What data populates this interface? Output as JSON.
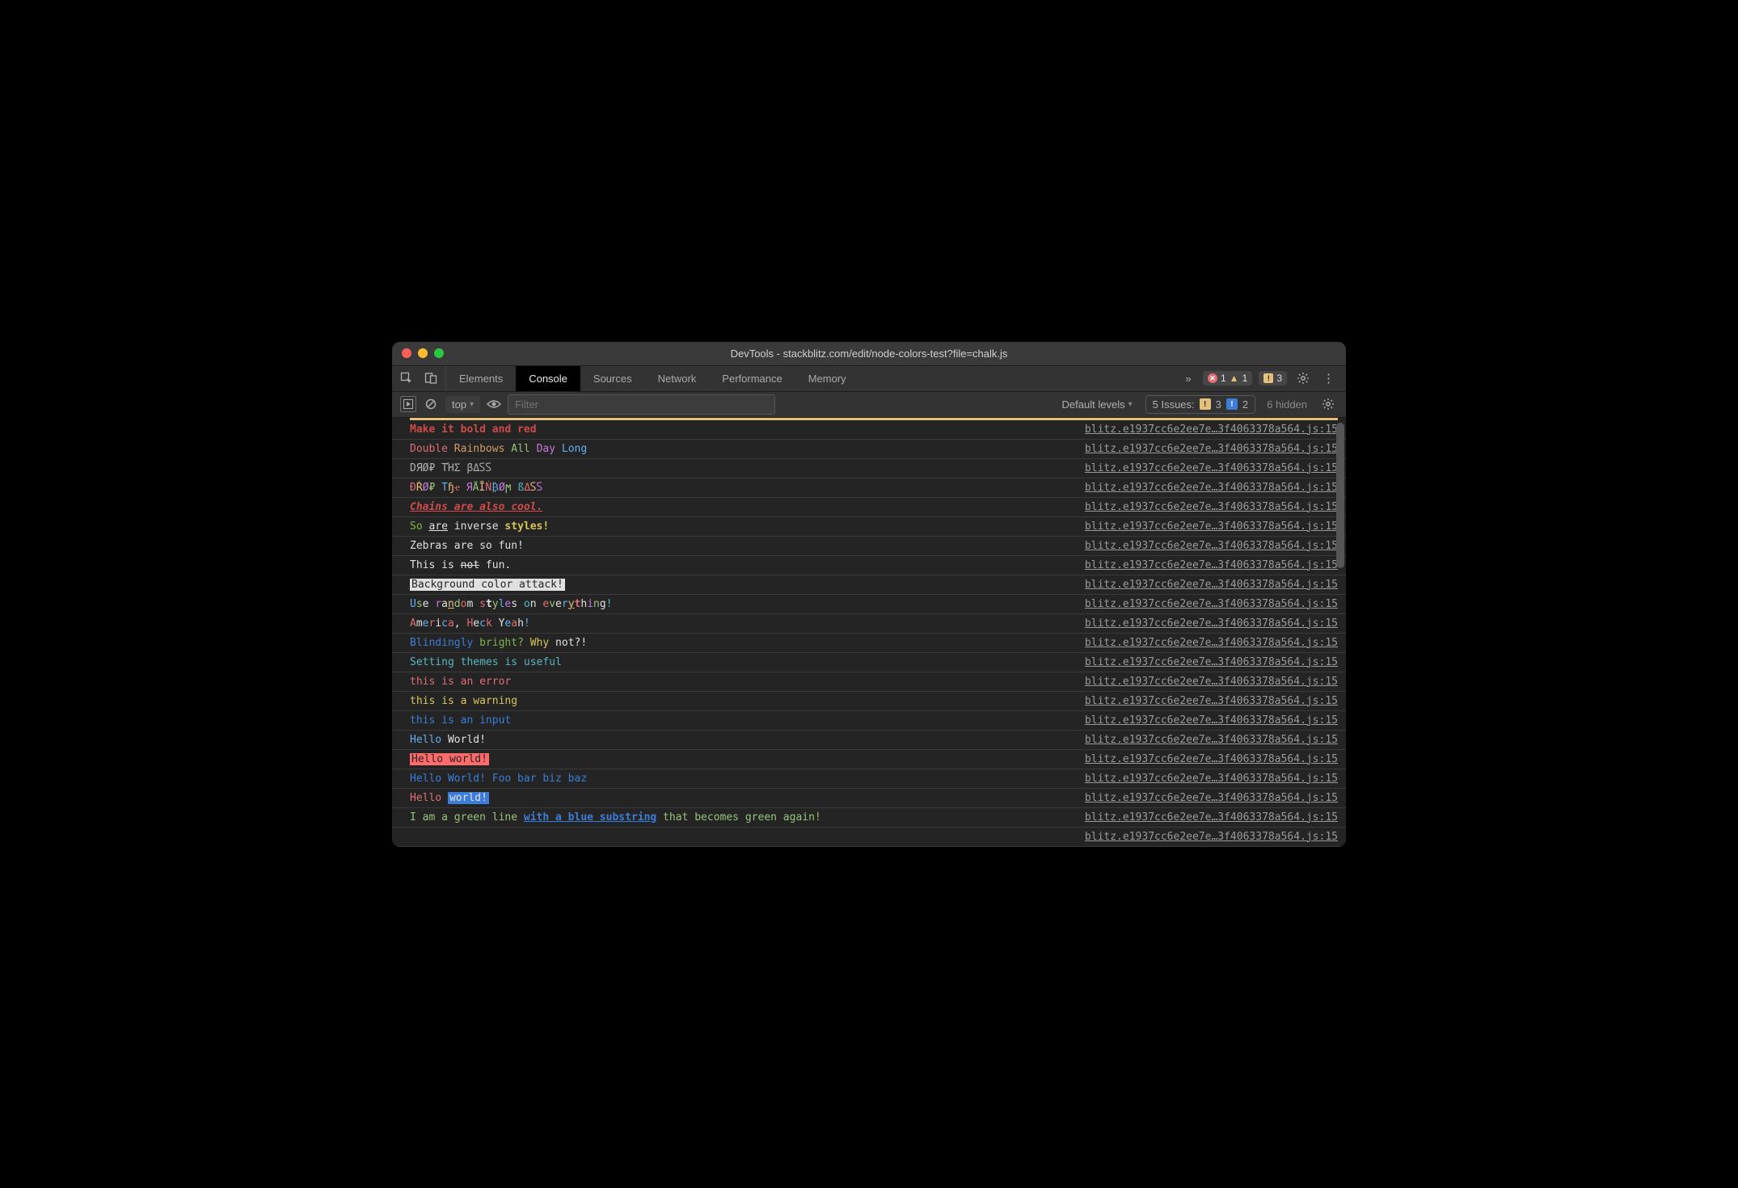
{
  "window": {
    "title": "DevTools - stackblitz.com/edit/node-colors-test?file=chalk.js"
  },
  "tabs": {
    "items": [
      "Elements",
      "Console",
      "Sources",
      "Network",
      "Performance",
      "Memory"
    ],
    "activeIndex": 1,
    "overflow_glyph": "»"
  },
  "badges": {
    "errors": "1",
    "warnings": "1",
    "issues": "3"
  },
  "toolbar": {
    "context": "top",
    "filter_placeholder": "Filter",
    "levels": "Default levels",
    "issues_label": "5 Issues:",
    "issues_warn": "3",
    "issues_info": "2",
    "hidden": "6 hidden"
  },
  "source_link": "blitz.e1937cc6e2ee7e…3f4063378a564.js:15",
  "lines": [
    {
      "parts": [
        {
          "t": "Make it bold and red",
          "cls": "bold red2"
        }
      ]
    },
    {
      "parts": [
        {
          "t": "Double",
          "cls": "red"
        },
        {
          "t": " "
        },
        {
          "t": "Rainbows",
          "cls": "orange"
        },
        {
          "t": " "
        },
        {
          "t": "All",
          "cls": "green"
        },
        {
          "t": " "
        },
        {
          "t": "Day",
          "cls": "magenta"
        },
        {
          "t": " "
        },
        {
          "t": "Long",
          "cls": "blue"
        }
      ]
    },
    {
      "parts": [
        {
          "t": "DЯØ₽ TΉΣ βΔ𐊖𐊖",
          "cls": "gray"
        }
      ]
    },
    {
      "parts": [
        {
          "t": "Ð",
          "cls": "red"
        },
        {
          "t": "Ŕ",
          "cls": "yellow"
        },
        {
          "t": "Ø",
          "cls": "magenta"
        },
        {
          "t": "₽",
          "cls": "green"
        },
        {
          "t": " "
        },
        {
          "t": "T",
          "cls": "blue"
        },
        {
          "t": "ɧ",
          "cls": "yellow"
        },
        {
          "t": "ҽ",
          "cls": "red"
        },
        {
          "t": " "
        },
        {
          "t": "Я",
          "cls": "magenta"
        },
        {
          "t": "Ǟ",
          "cls": "green"
        },
        {
          "t": "Ī",
          "cls": "yellow"
        },
        {
          "t": "Ń",
          "cls": "red"
        },
        {
          "t": "₿",
          "cls": "blue"
        },
        {
          "t": "Ø",
          "cls": "magenta"
        },
        {
          "t": "ϻ",
          "cls": "green"
        },
        {
          "t": " "
        },
        {
          "t": "ß",
          "cls": "cyan"
        },
        {
          "t": "Δ",
          "cls": "red"
        },
        {
          "t": "𐊖",
          "cls": "yellow"
        },
        {
          "t": "𐊖",
          "cls": "magenta"
        }
      ]
    },
    {
      "parts": [
        {
          "t": "Chains are also cool.",
          "cls": "bold italic underline red2"
        }
      ]
    },
    {
      "parts": [
        {
          "t": "So",
          "cls": "green2"
        },
        {
          "t": " "
        },
        {
          "t": "are",
          "cls": "white underline"
        },
        {
          "t": " "
        },
        {
          "t": "inverse",
          "cls": "white"
        },
        {
          "t": " "
        },
        {
          "t": "styles!",
          "cls": "bold yellow2"
        }
      ]
    },
    {
      "parts": [
        {
          "t": "Zebras are so fun!",
          "cls": "white"
        }
      ]
    },
    {
      "parts": [
        {
          "t": "This is ",
          "cls": "white"
        },
        {
          "t": "not",
          "cls": "white strike"
        },
        {
          "t": " fun.",
          "cls": "white"
        }
      ]
    },
    {
      "parts": [
        {
          "t": "Background color attack!",
          "cls": "bgwhite"
        }
      ]
    },
    {
      "parts": [
        {
          "t": "U",
          "cls": "blue"
        },
        {
          "t": "s",
          "cls": "green"
        },
        {
          "t": "e",
          "cls": "white"
        },
        {
          "t": " "
        },
        {
          "t": "r",
          "cls": "magenta"
        },
        {
          "t": "a",
          "cls": "white"
        },
        {
          "t": "n",
          "cls": "yellow underline"
        },
        {
          "t": "d",
          "cls": "green"
        },
        {
          "t": "o",
          "cls": "red"
        },
        {
          "t": "m",
          "cls": "white"
        },
        {
          "t": " "
        },
        {
          "t": "s",
          "cls": "red"
        },
        {
          "t": "t",
          "cls": "bold white"
        },
        {
          "t": "y",
          "cls": "green"
        },
        {
          "t": "l",
          "cls": "blue"
        },
        {
          "t": "e",
          "cls": "magenta"
        },
        {
          "t": "s",
          "cls": "white"
        },
        {
          "t": " "
        },
        {
          "t": "o",
          "cls": "cyan"
        },
        {
          "t": "n",
          "cls": "white"
        },
        {
          "t": " "
        },
        {
          "t": "e",
          "cls": "red"
        },
        {
          "t": "v",
          "cls": "green"
        },
        {
          "t": "e",
          "cls": "white"
        },
        {
          "t": "r",
          "cls": "blue"
        },
        {
          "t": "y",
          "cls": "yellow underline"
        },
        {
          "t": "t",
          "cls": "bold red"
        },
        {
          "t": "h",
          "cls": "white"
        },
        {
          "t": "i",
          "cls": "magenta"
        },
        {
          "t": "n",
          "cls": "green"
        },
        {
          "t": "g",
          "cls": "white"
        },
        {
          "t": "!",
          "cls": "cyan"
        }
      ]
    },
    {
      "parts": [
        {
          "t": "A",
          "cls": "red"
        },
        {
          "t": "m",
          "cls": "white"
        },
        {
          "t": "e",
          "cls": "blue"
        },
        {
          "t": "r",
          "cls": "red"
        },
        {
          "t": "i",
          "cls": "white"
        },
        {
          "t": "c",
          "cls": "blue"
        },
        {
          "t": "a",
          "cls": "red"
        },
        {
          "t": ", ",
          "cls": "white"
        },
        {
          "t": "H",
          "cls": "red"
        },
        {
          "t": "e",
          "cls": "white"
        },
        {
          "t": "c",
          "cls": "blue"
        },
        {
          "t": "k",
          "cls": "red"
        },
        {
          "t": " "
        },
        {
          "t": "Y",
          "cls": "white"
        },
        {
          "t": "e",
          "cls": "blue"
        },
        {
          "t": "a",
          "cls": "red"
        },
        {
          "t": "h",
          "cls": "white"
        },
        {
          "t": "!",
          "cls": "blue"
        }
      ]
    },
    {
      "parts": [
        {
          "t": "Blindingly",
          "cls": "blue2"
        },
        {
          "t": " "
        },
        {
          "t": "bright?",
          "cls": "green2"
        },
        {
          "t": " "
        },
        {
          "t": "Why",
          "cls": "yellow2"
        },
        {
          "t": " "
        },
        {
          "t": "not?!",
          "cls": "white"
        }
      ]
    },
    {
      "parts": [
        {
          "t": "Setting themes is useful",
          "cls": "cyan"
        }
      ]
    },
    {
      "parts": [
        {
          "t": "this is an error",
          "cls": "red"
        }
      ]
    },
    {
      "parts": [
        {
          "t": "this is a warning",
          "cls": "yellow2"
        }
      ]
    },
    {
      "parts": [
        {
          "t": "this is an input",
          "cls": "blue2"
        }
      ]
    },
    {
      "parts": [
        {
          "t": "Hello",
          "cls": "blue"
        },
        {
          "t": " World!",
          "cls": "white"
        }
      ]
    },
    {
      "parts": [
        {
          "t": "Hello world!",
          "cls": "bgred blue2"
        }
      ]
    },
    {
      "parts": [
        {
          "t": "Hello World! Foo bar biz baz",
          "cls": "blue2"
        }
      ]
    },
    {
      "parts": [
        {
          "t": "Hello ",
          "cls": "red"
        },
        {
          "t": "world!",
          "cls": "bgblue yellow2"
        }
      ]
    },
    {
      "parts": [
        {
          "t": "I am a green line ",
          "cls": "green"
        },
        {
          "t": "with a blue substring",
          "cls": "blue2 bold underline"
        },
        {
          "t": " that becomes green again!",
          "cls": "green"
        }
      ]
    },
    {
      "parts": [
        {
          "t": "",
          "cls": ""
        }
      ]
    }
  ]
}
